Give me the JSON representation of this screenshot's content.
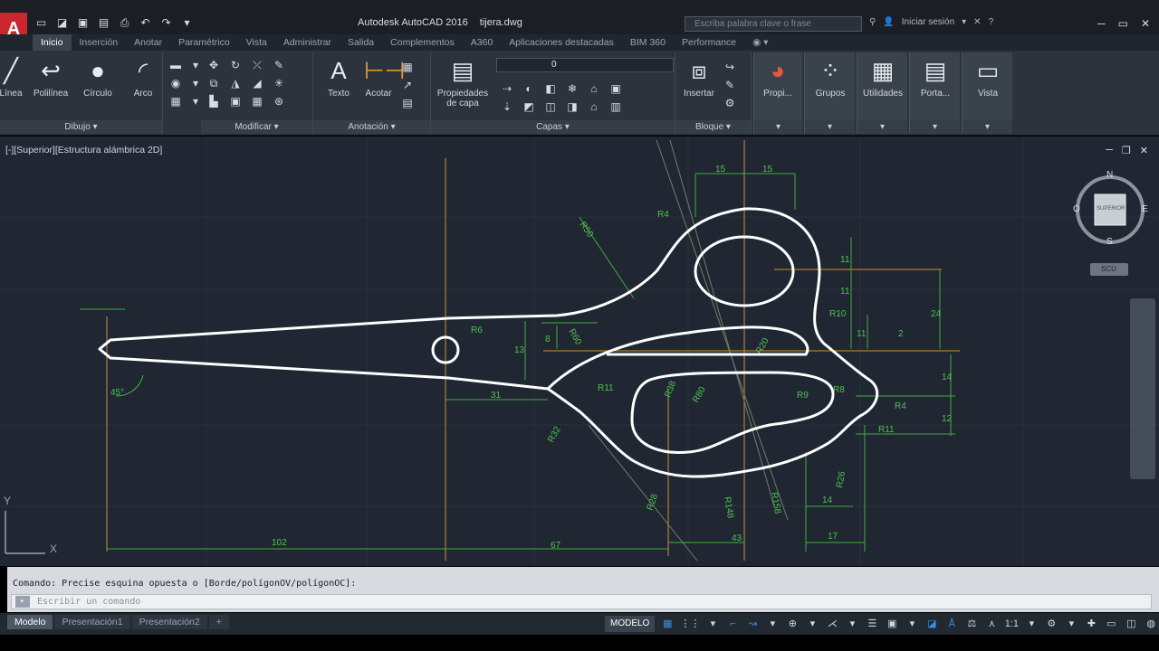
{
  "window": {
    "app_title": "Autodesk AutoCAD 2016",
    "doc_name": "tijera.dwg",
    "search_placeholder": "Escriba palabra clave o frase",
    "signin_label": "Iniciar sesión",
    "help_icon": "?"
  },
  "tabs": [
    "Inicio",
    "Inserción",
    "Anotar",
    "Paramétrico",
    "Vista",
    "Administrar",
    "Salida",
    "Complementos",
    "A360",
    "Aplicaciones destacadas",
    "BIM 360",
    "Performance"
  ],
  "active_tab": "Inicio",
  "ribbon": {
    "draw": {
      "title": "Dibujo",
      "line": "Línea",
      "polyline": "Polilínea",
      "circle": "Círculo",
      "arc": "Arco"
    },
    "modify": {
      "title": "Modificar"
    },
    "annotation": {
      "title": "Anotación",
      "text": "Texto",
      "dimension": "Acotar"
    },
    "layers": {
      "title": "Capas",
      "layer_props": "Propiedades de capa",
      "current_layer": "0"
    },
    "block": {
      "title": "Bloque",
      "insert": "Insertar"
    },
    "properties": {
      "label": "Propi..."
    },
    "groups": {
      "label": "Grupos"
    },
    "utilities": {
      "label": "Utilidades"
    },
    "clipboard": {
      "label": "Porta..."
    },
    "view": {
      "label": "Vista"
    }
  },
  "viewport": {
    "label": "[-][Superior][Estructura alámbrica 2D]",
    "cube_top": "SUPERIOR",
    "compass": {
      "n": "N",
      "s": "S",
      "e": "E",
      "o": "O"
    },
    "wcs": "SCU",
    "dimensions": {
      "d15a": "15",
      "d15b": "15",
      "r50": "R50",
      "r4": "R4",
      "d11a": "11",
      "d11b": "11",
      "d24": "24",
      "d2": "2",
      "r10a": "R10",
      "d8": "8",
      "d13": "13",
      "d11c": "11",
      "r60": "R60",
      "r50b": "R50",
      "r6": "R6",
      "d14": "14",
      "d12": "12",
      "r11a": "R11",
      "r11b": "R11",
      "r32": "R32",
      "r8": "R8",
      "r4b": "R4",
      "d45": "45°",
      "d31": "31",
      "d102": "102",
      "d67": "67",
      "d43": "43",
      "d14b": "14",
      "d17": "17",
      "r10b": "R10",
      "r148": "R148",
      "r158": "R158",
      "r28": "R28",
      "r20": "R20",
      "r26": "R26",
      "r80": "R80",
      "r9": "R9",
      "r38": "R38"
    }
  },
  "command": {
    "history": "Comando: Precise esquina opuesta o [Borde/polígonOV/polígonOC]:",
    "placeholder": "Escribir un comando"
  },
  "layout_tabs": [
    "Modelo",
    "Presentación1",
    "Presentación2",
    "+"
  ],
  "active_layout": "Modelo",
  "status": {
    "model": "MODELO",
    "scale": "1:1"
  },
  "colors": {
    "background": "#202733",
    "dim_green": "#4cc24c",
    "geometry": "#ffffff",
    "axis_orange": "#c8913a"
  }
}
